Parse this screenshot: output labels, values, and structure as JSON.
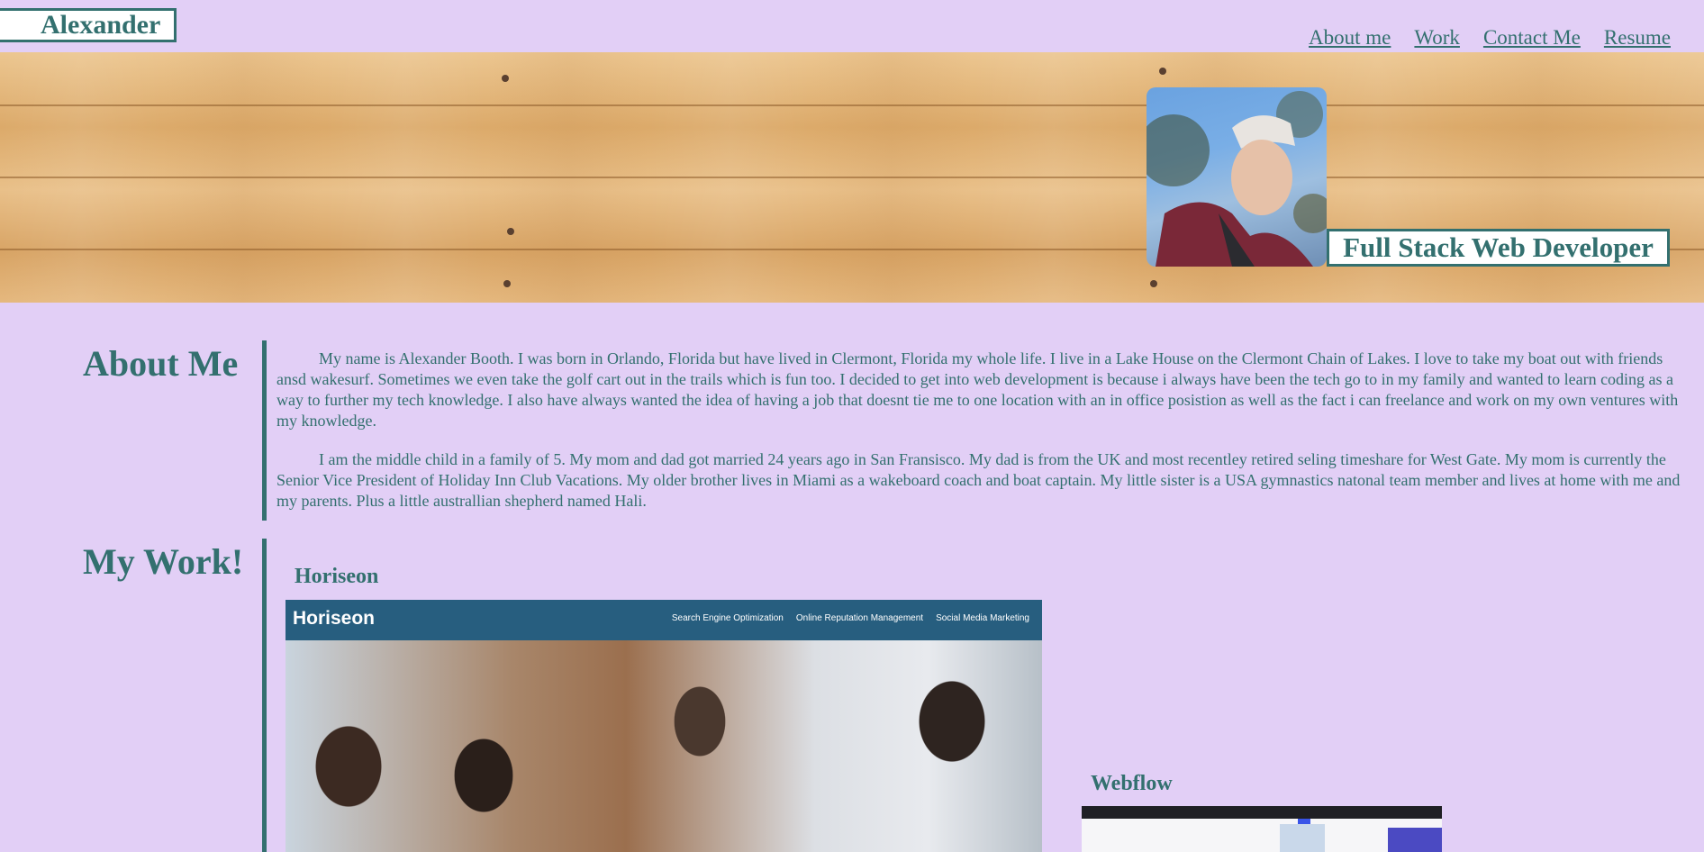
{
  "brand": {
    "name": "Alexander"
  },
  "nav": {
    "items": [
      "About me",
      "Work",
      "Contact Me",
      "Resume"
    ]
  },
  "hero": {
    "title": "Full Stack Web Developer"
  },
  "about": {
    "heading": "About Me",
    "paragraphs": [
      "My name is Alexander Booth. I was born in Orlando, Florida but have lived in Clermont, Florida my whole life. I live in a Lake House on the Clermont Chain of Lakes. I love to take my boat out with friends ansd wakesurf. Sometimes we even take the golf cart out in the trails which is fun too. I decided to get into web development is because i always have been the tech go to in my family and wanted to learn coding as a way to further my tech knowledge. I also have always wanted the idea of having a job that doesnt tie me to one location with an in office posistion as well as the fact i can freelance and work on my own ventures with my knowledge.",
      "I am the middle child in a family of 5. My mom and dad got married 24 years ago in San Fransisco. My dad is from the UK and most recentley retired seling timeshare for West Gate. My mom is currently the Senior Vice President of Holiday Inn Club Vacations. My older brother lives in Miami as a wakeboard coach and boat captain. My little sister is a USA gymnastics natonal team member and lives at home with me and my parents. Plus a little australlian shepherd named Hali."
    ]
  },
  "work": {
    "heading": "My Work!",
    "projects": [
      {
        "title": "Horiseon",
        "screenshot": {
          "logo": "Horiseon",
          "links": [
            "Search Engine Optimization",
            "Online Reputation Management",
            "Social Media Marketing"
          ]
        }
      },
      {
        "title": "Webflow"
      }
    ]
  }
}
